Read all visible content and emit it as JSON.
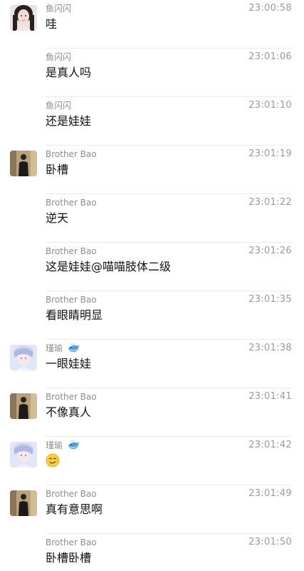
{
  "messages": [
    {
      "sender": "鱼闪闪",
      "time": "23:00:58",
      "text": "哇",
      "avatar": "girl-avatar"
    },
    {
      "sender": "鱼闪闪",
      "time": "23:01:06",
      "text": "是真人吗",
      "avatar": null
    },
    {
      "sender": "鱼闪闪",
      "time": "23:01:10",
      "text": "还是娃娃",
      "avatar": null
    },
    {
      "sender": "Brother Bao",
      "time": "23:01:19",
      "text": "卧槽",
      "avatar": "man-avatar"
    },
    {
      "sender": "Brother Bao",
      "time": "23:01:22",
      "text": "逆天",
      "avatar": null
    },
    {
      "sender": "Brother Bao",
      "time": "23:01:26",
      "text": "这是娃娃@喵喵肢体二级",
      "avatar": null
    },
    {
      "sender": "Brother Bao",
      "time": "23:01:35",
      "text": "看眼睛明显",
      "avatar": null
    },
    {
      "sender": "瑾瑜",
      "time": "23:01:38",
      "text": "一眼娃娃",
      "avatar": "anime-avatar",
      "badge": "whale-emoji"
    },
    {
      "sender": "Brother Bao",
      "time": "23:01:41",
      "text": "不像真人",
      "avatar": "man-avatar"
    },
    {
      "sender": "瑾瑜",
      "time": "23:01:42",
      "text": "",
      "avatar": "anime-avatar",
      "badge": "whale-emoji",
      "emoji": "smirk-emoji"
    },
    {
      "sender": "Brother Bao",
      "time": "23:01:49",
      "text": "真有意思啊",
      "avatar": "man-avatar"
    },
    {
      "sender": "Brother Bao",
      "time": "23:01:50",
      "text": "卧槽卧槽",
      "avatar": null
    }
  ],
  "colors": {
    "background": "#ffffff",
    "sender_text": "#8e8e8e",
    "time_text": "#9a9a9a",
    "message_text": "#111111",
    "divider": "#ececec"
  }
}
